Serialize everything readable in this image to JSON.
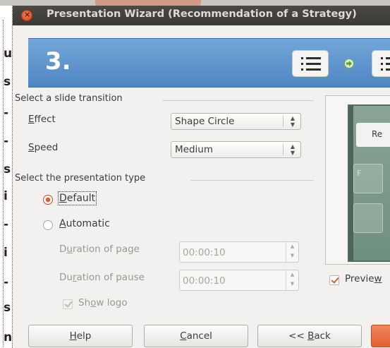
{
  "window": {
    "title": "Presentation Wizard (Recommendation of a Strategy)"
  },
  "doc_strip": {
    "chars": [
      "u",
      "s",
      "-",
      "-",
      "s",
      "i",
      "-",
      "i",
      "-",
      "s",
      "n"
    ]
  },
  "banner": {
    "step": "3.",
    "color": "#5a8fca"
  },
  "transition_group": {
    "title": "Select a slide transition",
    "effect_label_u": "E",
    "effect_label_rest": "ffect",
    "effect_value": "Shape Circle",
    "speed_label_u": "S",
    "speed_label_rest": "peed",
    "speed_value": "Medium"
  },
  "type_group": {
    "title": "Select the presentation type",
    "default_u": "D",
    "default_rest": "efault",
    "default_selected": true,
    "automatic_u": "A",
    "automatic_rest": "utomatic",
    "automatic_selected": false,
    "duration_page_label_pre": "D",
    "duration_page_label_u": "u",
    "duration_page_label_rest": "ration of page",
    "duration_page_value": "00:00:10",
    "duration_pause_label_pre": "Du",
    "duration_pause_label_u": "r",
    "duration_pause_label_rest": "ation of pause",
    "duration_pause_value": "00:00:10",
    "show_logo_pre": "Sh",
    "show_logo_u": "o",
    "show_logo_rest": "w logo",
    "show_logo_checked": true
  },
  "preview": {
    "card_text": "Re",
    "ghost_text": "F",
    "checkbox_label_pre": "Preview",
    "checkbox_label_u": "w",
    "checkbox_label_shown": "Previe",
    "checked": true
  },
  "buttons": {
    "help_u": "H",
    "help_rest": "elp",
    "cancel_u": "C",
    "cancel_rest": "ancel",
    "back_pre": "<< ",
    "back_u": "B",
    "back_rest": "ack"
  },
  "colors": {
    "accent": "#e35f2f",
    "titlebar": "#3c3b37",
    "banner": "#5a8fca"
  }
}
